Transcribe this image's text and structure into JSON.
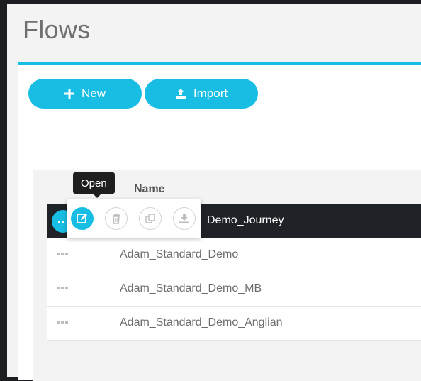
{
  "page": {
    "title": "Flows"
  },
  "toolbar": {
    "new_label": "New",
    "import_label": "Import"
  },
  "table": {
    "headers": {
      "name": "Name"
    },
    "rows": [
      {
        "name": "Demo_Journey",
        "selected": true
      },
      {
        "name": "Adam_Standard_Demo"
      },
      {
        "name": "Adam_Standard_Demo_MB"
      },
      {
        "name": "Adam_Standard_Demo_Anglian"
      }
    ]
  },
  "row_actions": {
    "tooltip": "Open",
    "items": [
      "open",
      "delete",
      "duplicate",
      "export"
    ]
  },
  "icons": {
    "new": "plus-icon",
    "import": "upload-icon",
    "row_menu": "more-icon",
    "open": "edit-icon",
    "delete": "trash-icon",
    "duplicate": "copy-icon",
    "export": "download-icon"
  },
  "colors": {
    "accent": "#17bde3",
    "selected_row": "#1f2227",
    "page_bg": "#f3f3f3"
  }
}
